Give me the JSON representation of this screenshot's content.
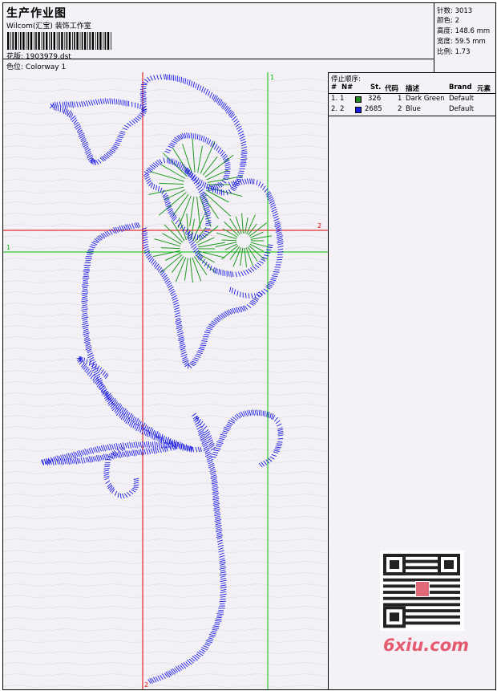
{
  "header": {
    "title": "生产作业图",
    "company": "Wilcom(汇宝) 装饰工作室",
    "design_label": "花版:",
    "design_value": "1903979.dst",
    "colorway_label": "色位:",
    "colorway_value": "Colorway 1"
  },
  "stats": {
    "stitches": "针数: 3013",
    "colors": "颜色: 2",
    "height": "高度: 148.6 mm",
    "width": "宽度: 59.5 mm",
    "ratio": "比例: 1.73"
  },
  "stop_sequence": {
    "title": "停止顺序:",
    "columns": [
      "#",
      "N#",
      "St.",
      "代码",
      "描述",
      "Brand",
      "元素"
    ],
    "rows": [
      {
        "idx": "1.",
        "n": "1",
        "st": "326",
        "code": "1",
        "desc": "Dark Green",
        "brand": "Default",
        "color": "#1f8a1f"
      },
      {
        "idx": "2.",
        "n": "2",
        "st": "2685",
        "code": "2",
        "desc": "Blue",
        "brand": "Default",
        "color": "#1a1ae0"
      }
    ]
  },
  "guides": {
    "red_v_label": "2",
    "red_h_label": "2",
    "green_v_label": "1",
    "green_h_label": "1",
    "red_color": "#e00000",
    "green_color": "#00c000"
  },
  "watermark": "6xiu.com",
  "colors": {
    "stitch_blue": "#1a1ae0",
    "stitch_green": "#1f9a1f"
  }
}
